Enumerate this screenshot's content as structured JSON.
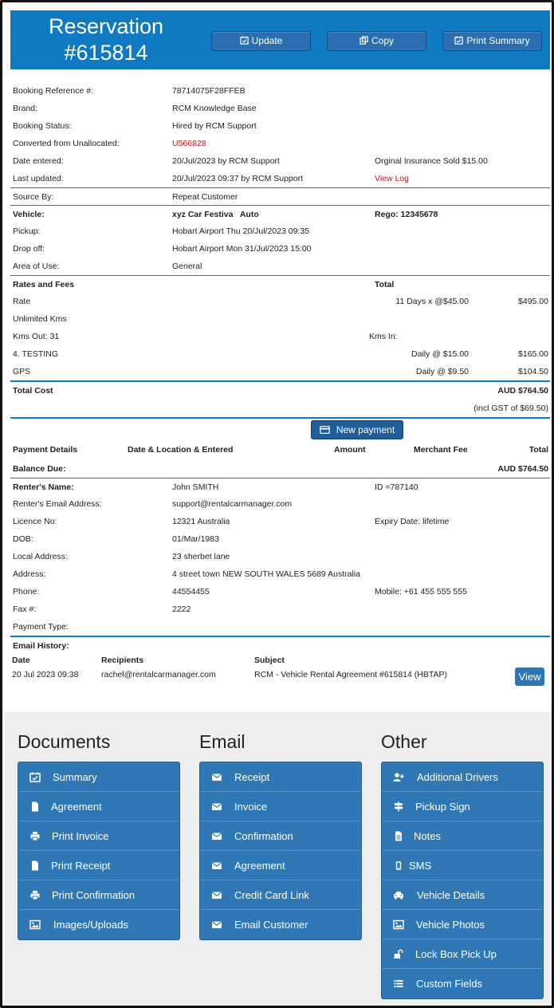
{
  "header": {
    "title_line1": "Reservation",
    "title_line2": "#615814",
    "update_label": "Update",
    "copy_label": "Copy",
    "print_summary_label": "Print Summary"
  },
  "details": {
    "booking_ref_label": "Booking Reference #:",
    "booking_ref": "78714075F28FFEB",
    "brand_label": "Brand:",
    "brand": "RCM Knowledge Base",
    "status_label": "Booking Status:",
    "status": "Hired by RCM Support",
    "converted_label": "Converted from Unallocated:",
    "converted": "U566828",
    "date_entered_label": "Date entered:",
    "date_entered": "20/Jul/2023 by RCM Support",
    "insurance": "Orginal Insurance Sold $15.00",
    "last_updated_label": "Last updated:",
    "last_updated": "20/Jul/2023 09:37 by RCM Support",
    "view_log": "View Log",
    "source_label": "Source By:",
    "source": "Repeat Customer"
  },
  "vehicle": {
    "label": "Vehicle:",
    "name": "xyz Car Festiva   Auto",
    "rego": "Rego: 12345678",
    "pickup_label": "Pickup:",
    "pickup": "Hobart Airport Thu 20/Jul/2023 09:35",
    "dropoff_label": "Drop off:",
    "dropoff": "Hobart Airport Mon 31/Jul/2023 15:00",
    "area_label": "Area of Use:",
    "area": "General"
  },
  "rates": {
    "header": "Rates and Fees",
    "total_header": "Total",
    "rate_label": "Rate",
    "rate_desc": "11 Days x @$45.00",
    "rate_total": "$495.00",
    "unlimited": "Unlimited Kms",
    "kms_out": "Kms Out: 31",
    "kms_in": "Kms In:",
    "testing_label": "4. TESTING",
    "testing_desc": "Daily @ $15.00",
    "testing_total": "$165.00",
    "gps_label": "GPS",
    "gps_desc": "Daily @ $9.50",
    "gps_total": "$104.50",
    "total_cost_label": "Total Cost",
    "total_cost": "AUD $764.50",
    "gst": "(incl GST of $69.50)"
  },
  "payment": {
    "new_payment": "New payment",
    "details_header": "Payment Details",
    "date_header": "Date & Location & Entered",
    "amount_header": "Amount",
    "merchant_header": "Merchant Fee",
    "total_header": "Total",
    "balance_label": "Balance Due:",
    "balance": "AUD $764.50"
  },
  "renter": {
    "name_label": "Renter's Name:",
    "name": "John SMITH",
    "id": "ID =787140",
    "email_label": "Renter's Email Address:",
    "email": "support@rentalcarmanager.com",
    "licence_label": "Licence No:",
    "licence": "12321 Australia",
    "expiry": "Expiry Date: lifetime",
    "dob_label": "DOB:",
    "dob": "01/Mar/1983",
    "local_label": "Local Address:",
    "local": "23 sherbet lane",
    "address_label": "Address:",
    "address": "4 street town NEW SOUTH WALES 5689 Australia",
    "phone_label": "Phone:",
    "phone": "44554455",
    "mobile": "Mobile: +61 455 555 555",
    "fax_label": "Fax #:",
    "fax": "2222",
    "payment_type_label": "Payment Type:"
  },
  "email_history": {
    "title": "Email History:",
    "date_header": "Date",
    "recipients_header": "Recipients",
    "subject_header": "Subject",
    "date": "20 Jul 2023 09:38",
    "recipient": "rachel@rentalcarmanager.com",
    "subject": "RCM - Vehicle Rental Agreement #615814 (HBTAP)",
    "view": "View"
  },
  "documents": {
    "title": "Documents",
    "items": [
      "Summary",
      "Agreement",
      "Print Invoice",
      "Print Receipt",
      "Print Confirmation",
      "Images/Uploads"
    ]
  },
  "email": {
    "title": "Email",
    "items": [
      "Receipt",
      "Invoice",
      "Confirmation",
      "Agreement",
      "Credit Card Link",
      "Email Customer"
    ]
  },
  "other": {
    "title": "Other",
    "items": [
      "Additional Drivers",
      "Pickup Sign",
      "Notes",
      "SMS",
      "Vehicle Details",
      "Vehicle Photos",
      "Lock Box Pick Up",
      "Custom Fields"
    ]
  },
  "icons": {
    "documents": [
      "calendar-check-icon",
      "file-icon",
      "printer-icon",
      "file-icon",
      "printer-icon",
      "image-icon"
    ],
    "email": [
      "envelope-icon",
      "envelope-icon",
      "envelope-icon",
      "envelope-icon",
      "envelope-icon",
      "envelope-icon"
    ],
    "other": [
      "user-plus-icon",
      "signpost-icon",
      "note-icon",
      "mobile-icon",
      "car-icon",
      "image-icon",
      "unlock-icon",
      "list-icon"
    ]
  },
  "colors": {
    "header_bg": "#0f7ac2",
    "panel_bg": "#2f78b5",
    "link_red": "#d0161d"
  }
}
